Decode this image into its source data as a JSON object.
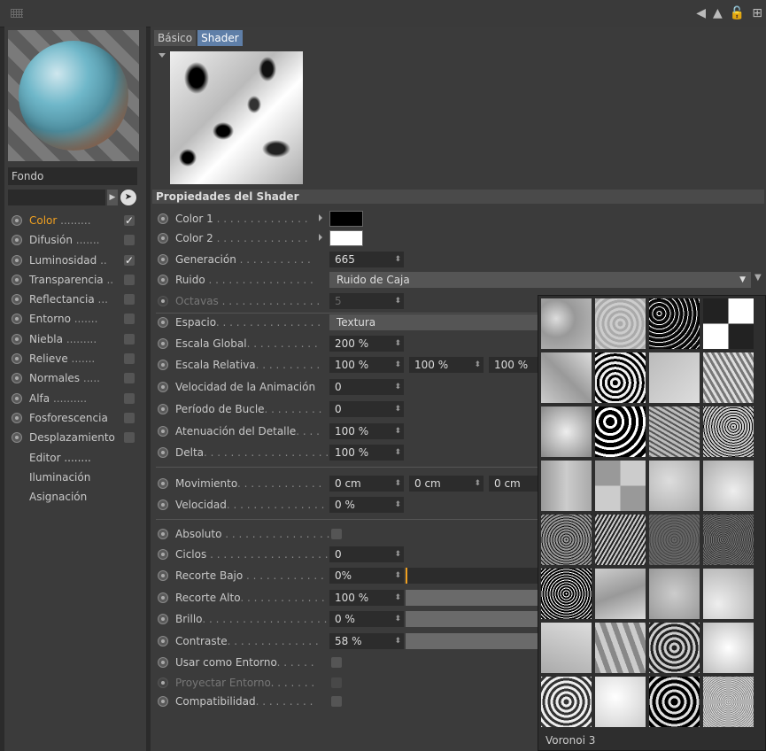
{
  "left": {
    "material_name": "Fondo",
    "channels": [
      {
        "label": "Color",
        "dots": ".........",
        "checked": true,
        "active": true
      },
      {
        "label": "Difusión",
        "dots": ".......",
        "checked": false
      },
      {
        "label": "Luminosidad",
        "dots": "..",
        "checked": true
      },
      {
        "label": "Transparencia",
        "dots": "..",
        "checked": false
      },
      {
        "label": "Reflectancia",
        "dots": "...",
        "checked": false
      },
      {
        "label": "Entorno",
        "dots": ".......",
        "checked": false
      },
      {
        "label": "Niebla",
        "dots": ".........",
        "checked": false
      },
      {
        "label": "Relieve",
        "dots": ".......",
        "checked": false
      },
      {
        "label": "Normales",
        "dots": ".....",
        "checked": false
      },
      {
        "label": "Alfa",
        "dots": "..........",
        "checked": false
      },
      {
        "label": "Fosforescencia",
        "dots": "",
        "checked": false
      },
      {
        "label": "Desplazamiento",
        "dots": "",
        "checked": false
      }
    ],
    "plain_items": [
      "Editor ........",
      "Iluminación",
      "Asignación"
    ]
  },
  "tabs": [
    "Básico",
    "Shader"
  ],
  "section_title": "Propiedades del Shader",
  "params": {
    "color1": {
      "label": "Color 1",
      "dots": " . . . . . . . . . . . . . . ",
      "value": "#000000"
    },
    "color2": {
      "label": "Color 2",
      "dots": " . . . . . . . . . . . . . . ",
      "value": "#ffffff"
    },
    "generacion": {
      "label": "Generación",
      "dots": " . . . . . . . . . . . ",
      "value": "665"
    },
    "ruido": {
      "label": "Ruido",
      "dots": " . . . . . . . . . . . . . . . . ",
      "value": "Ruido de Caja"
    },
    "octavas": {
      "label": "Octavas",
      "dots": " . . . . . . . . . . . . . . . ",
      "value": "5"
    },
    "espacio": {
      "label": "Espacio",
      "dots": ". . . . . . . . . . . . . . . .",
      "value": "Textura"
    },
    "escala_global": {
      "label": "Escala Global",
      "dots": ". . . . . . . . . . .",
      "value": "200 %"
    },
    "escala_relativa": {
      "label": "Escala Relativa",
      "dots": ". . . . . . . . . . ",
      "values": [
        "100 %",
        "100 %",
        "100 %"
      ]
    },
    "velocidad_anim": {
      "label": "Velocidad de la Animación",
      "dots": "",
      "value": "0"
    },
    "periodo_bucle": {
      "label": "Período de Bucle",
      "dots": ". . . . . . . . .",
      "value": "0"
    },
    "atenuacion": {
      "label": "Atenuación del Detalle",
      "dots": ". . . .",
      "value": "100 %"
    },
    "delta": {
      "label": "Delta",
      "dots": ". . . . . . . . . . . . . . . . . . . . .",
      "value": "100 %"
    },
    "movimiento": {
      "label": "Movimiento",
      "dots": ". . . . . . . . . . . . .",
      "values": [
        "0 cm",
        "0 cm",
        "0 cm"
      ]
    },
    "velocidad": {
      "label": "Velocidad",
      "dots": ". . . . . . . . . . . . . . .",
      "value": "0 %"
    },
    "absoluto": {
      "label": "Absoluto",
      "dots": " . . . . . . . . . . . . . . . .",
      "checked": false
    },
    "ciclos": {
      "label": "Ciclos",
      "dots": " . . . . . . . . . . . . . . . . . . . .",
      "value": "0"
    },
    "recorte_bajo": {
      "label": "Recorte Bajo",
      "dots": " . . . . . . . . . . . .",
      "value": "0%"
    },
    "recorte_alto": {
      "label": "Recorte Alto",
      "dots": ". . . . . . . . . . . . .",
      "value": "100 %"
    },
    "brillo": {
      "label": "Brillo",
      "dots": ". . . . . . . . . . . . . . . . . . . .",
      "value": "0 %"
    },
    "contraste": {
      "label": "Contraste",
      "dots": ". . . . . . . . . . . . . .",
      "value": "58 %"
    },
    "usar_entorno": {
      "label": "Usar como Entorno",
      "dots": ". . . . . .",
      "checked": false
    },
    "proyectar_entorno": {
      "label": "Proyectar Entorno",
      "dots": ". . . . . . .",
      "checked": false
    },
    "compatibilidad": {
      "label": "Compatibilidad",
      "dots": ". . . . . . . . .",
      "checked": false
    }
  },
  "noise_popup": {
    "hover_label": "Voronoi 3"
  }
}
